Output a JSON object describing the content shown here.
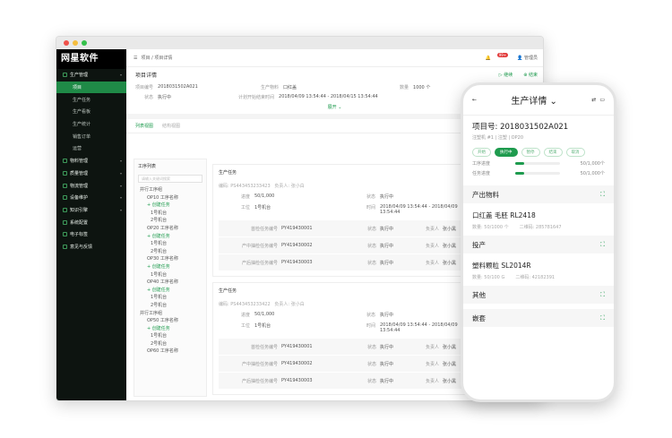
{
  "brand": "网星软件",
  "sidebar": {
    "items": [
      {
        "label": "生产管理",
        "type": "top"
      },
      {
        "label": "项目",
        "type": "act"
      },
      {
        "label": "生产任务",
        "type": "sub"
      },
      {
        "label": "生产看板",
        "type": "sub"
      },
      {
        "label": "生产统计",
        "type": "sub"
      },
      {
        "label": "销售订单",
        "type": "sub"
      },
      {
        "label": "运营",
        "type": "sub"
      },
      {
        "label": "物料管理",
        "type": "top"
      },
      {
        "label": "质量管理",
        "type": "top"
      },
      {
        "label": "物流管理",
        "type": "top"
      },
      {
        "label": "设备维护",
        "type": "top"
      },
      {
        "label": "知识引擎",
        "type": "top"
      },
      {
        "label": "系统配置",
        "type": "top"
      },
      {
        "label": "电子标签",
        "type": "top"
      },
      {
        "label": "意见与反馈",
        "type": "top"
      }
    ]
  },
  "header": {
    "breadcrumb": "项目 / 项目详情",
    "badge": "99+",
    "user": "管理员"
  },
  "detail": {
    "title": "项目详情",
    "project_no_label": "项目编号",
    "project_no": "2018031502A021",
    "product_label": "生产物料",
    "product": "口红盖",
    "qty_label": "数量",
    "qty": "1000 个",
    "status_label": "状态",
    "status": "执行中",
    "plan_label": "计划开始结束时间",
    "plan": "2018/04/09 13:54:44 - 2018/04/15 13:54:44",
    "expand": "展开 ⌄",
    "act1": "继续",
    "act2": "结束",
    "act3": "编辑",
    "act4": "查看操作记录"
  },
  "tabs": {
    "t1": "列表视图",
    "t2": "结构视图"
  },
  "proc": {
    "title": "工序列表",
    "search": "请输入关键词搜索",
    "rows": [
      {
        "t": "并行工序组",
        "c": ""
      },
      {
        "t": "OP10 工序名称",
        "c": "s"
      },
      {
        "t": "+ 创建任务",
        "c": "g"
      },
      {
        "t": "1号机台",
        "c": "ss"
      },
      {
        "t": "2号机台",
        "c": "ss"
      },
      {
        "t": "OP20 工序名称",
        "c": "s"
      },
      {
        "t": "+ 创建任务",
        "c": "g"
      },
      {
        "t": "1号机台",
        "c": "ss"
      },
      {
        "t": "2号机台",
        "c": "ss"
      },
      {
        "t": "OP30 工序名称",
        "c": "s"
      },
      {
        "t": "+ 创建任务",
        "c": "g"
      },
      {
        "t": "1号机台",
        "c": "ss"
      },
      {
        "t": "OP40 工序名称",
        "c": "c"
      },
      {
        "t": "+ 创建任务",
        "c": "g"
      },
      {
        "t": "1号机台",
        "c": "ss"
      },
      {
        "t": "2号机台",
        "c": "ss"
      },
      {
        "t": "并行工序组",
        "c": ""
      },
      {
        "t": "OP50 工序名称",
        "c": "s"
      },
      {
        "t": "+ 创建任务",
        "c": "g"
      },
      {
        "t": "1号机台",
        "c": "ss"
      },
      {
        "t": "2号机台",
        "c": "ss"
      },
      {
        "t": "OP60 工序名称",
        "c": "s"
      }
    ]
  },
  "cards": [
    {
      "title": "生产任务",
      "code": "编码: PS443453233423",
      "owner": "负责人: 张小白",
      "qty_k": "进度",
      "qty": "50/1,000",
      "st_k": "状态",
      "st": "执行中",
      "mc_k": "工位",
      "mc": "1号机台",
      "tm_k": "时间",
      "tm": "2018/04/09 13:54:44 - 2018/04/09 13:54:44",
      "tasks": [
        {
          "k": "首检任务编号",
          "v": "PY419430001",
          "sk": "状态",
          "sv": "执行中",
          "ok": "负责人",
          "ov": "张小黑"
        },
        {
          "k": "产中抽检任务编号",
          "v": "PY419430002",
          "sk": "状态",
          "sv": "执行中",
          "ok": "负责人",
          "ov": "张小黑"
        },
        {
          "k": "产后抽检任务编号",
          "v": "PY419430003",
          "sk": "状态",
          "sv": "执行中",
          "ok": "负责人",
          "ov": "张小黑"
        }
      ]
    },
    {
      "title": "生产任务",
      "code": "编码: PS443453233422",
      "owner": "负责人: 张小白",
      "qty_k": "进度",
      "qty": "50/1,000",
      "st_k": "状态",
      "st": "执行中",
      "mc_k": "工位",
      "mc": "1号机台",
      "tm_k": "时间",
      "tm": "2018/04/09 13:54:44 - 2018/04/09 13:54:44",
      "tasks": [
        {
          "k": "首检任务编号",
          "v": "PY419430001",
          "sk": "状态",
          "sv": "执行中",
          "ok": "负责人",
          "ov": "张小黑"
        },
        {
          "k": "产中抽检任务编号",
          "v": "PY419430002",
          "sk": "状态",
          "sv": "执行中",
          "ok": "负责人",
          "ov": "张小黑"
        },
        {
          "k": "产后抽检任务编号",
          "v": "PY419430003",
          "sk": "状态",
          "sv": "执行中",
          "ok": "负责人",
          "ov": "张小黑"
        }
      ]
    }
  ],
  "phone": {
    "title": "生产详情 ⌄",
    "notif": "8",
    "project": "项目号: 2018031502A021",
    "sub": "注塑机 #1 | 注塑 | OP20",
    "steps": [
      "开始",
      "执行中",
      "暂停",
      "结束",
      "取消"
    ],
    "progress": [
      {
        "label": "工序进度",
        "val": "50/1,000个",
        "pct": 0.05
      },
      {
        "label": "任务进度",
        "val": "50/1,000个",
        "pct": 0.05
      }
    ],
    "out_title": "产出物料",
    "out_name": "口红盖 毛胚 RL2418",
    "out_qty": "数量: 50/1000 个",
    "out_code": "二维码: 285781647",
    "in_title": "投产",
    "in_name": "塑料颗粒 SL2014R",
    "in_qty": "数量: 50/100 G",
    "in_code": "二维码: 42182391",
    "other": "其他",
    "mold": "嵌套"
  },
  "colors": {
    "accent": "#1e9b4e",
    "sidebar": "#0d1410"
  }
}
